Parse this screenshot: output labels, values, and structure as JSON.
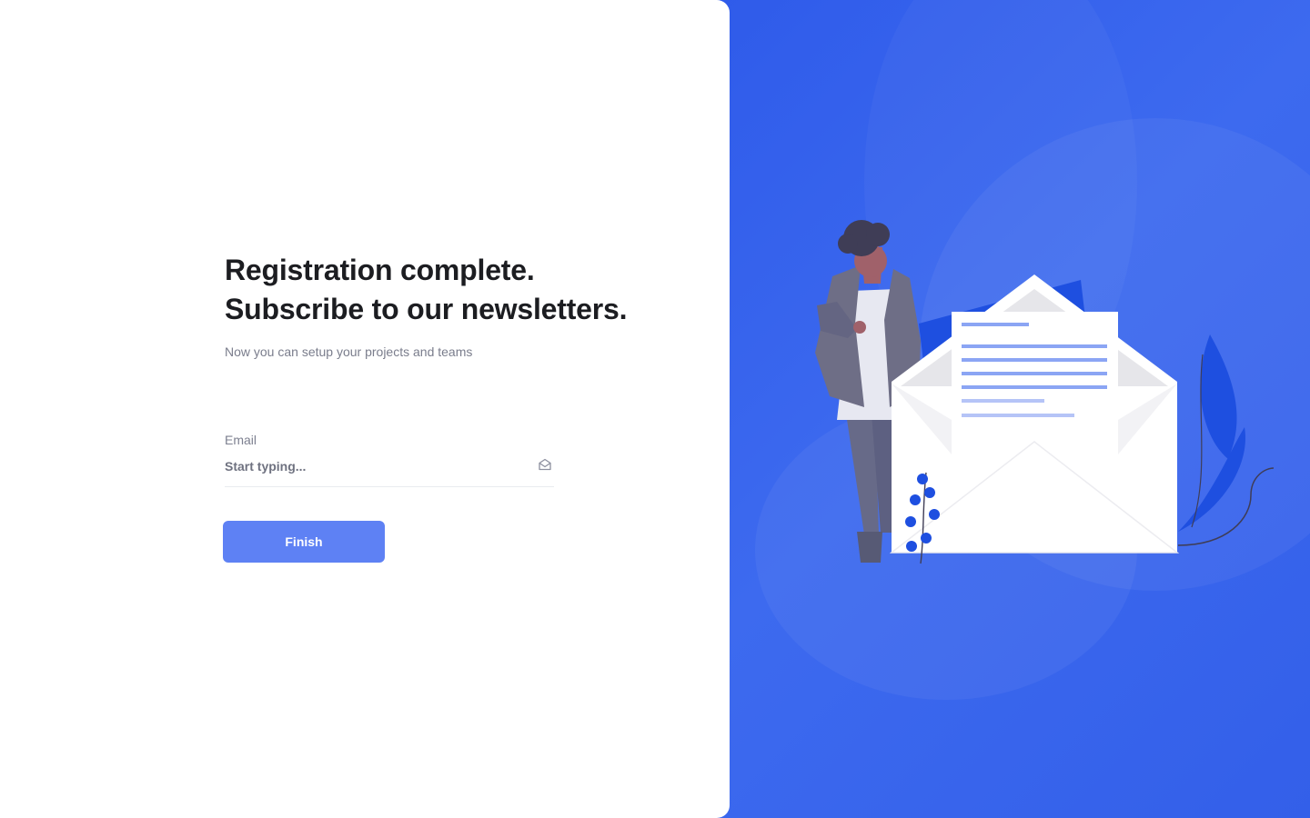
{
  "heading": {
    "line1": "Registration complete.",
    "line2": "Subscribe to our newsletters."
  },
  "subtitle": "Now you can setup your projects and teams",
  "form": {
    "email_label": "Email",
    "email_placeholder": "Start typing...",
    "email_value": "",
    "email_icon": "mail-open-icon",
    "submit_label": "Finish"
  },
  "colors": {
    "accent": "#5e81f4",
    "illustration_background": "#3562ec",
    "heading_text": "#1c1d21",
    "muted_text": "#7a7d8c"
  },
  "illustration": {
    "subject": "person standing beside an open envelope with a letter",
    "icons": [
      "person-figure",
      "envelope-icon",
      "letter-icon",
      "leaf-plant-icon",
      "sprig-plant-icon"
    ]
  }
}
